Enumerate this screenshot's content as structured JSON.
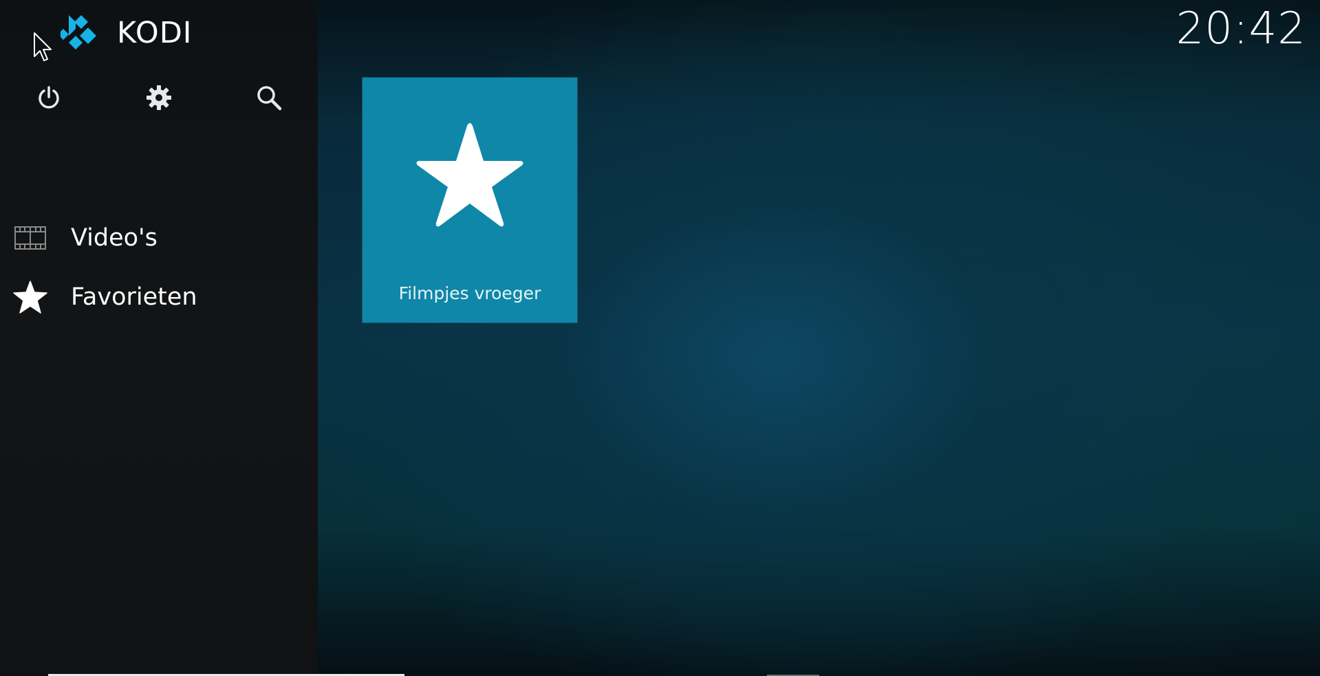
{
  "app": {
    "brand": "KODI",
    "clock": "20:42"
  },
  "topbar": {
    "icons": [
      "power-icon",
      "gear-icon",
      "search-icon"
    ]
  },
  "sidebar": {
    "items": [
      {
        "label": "Video's",
        "icon": "film-icon"
      },
      {
        "label": "Favorieten",
        "icon": "star-icon"
      }
    ]
  },
  "main": {
    "favourites": [
      {
        "label": "Filmpjes vroeger",
        "icon": "star-icon",
        "color": "#0f87a8"
      }
    ]
  },
  "colors": {
    "accent": "#0f87a8",
    "logo": "#17b2e7",
    "sidebar": "#121416",
    "background": "#093245"
  }
}
